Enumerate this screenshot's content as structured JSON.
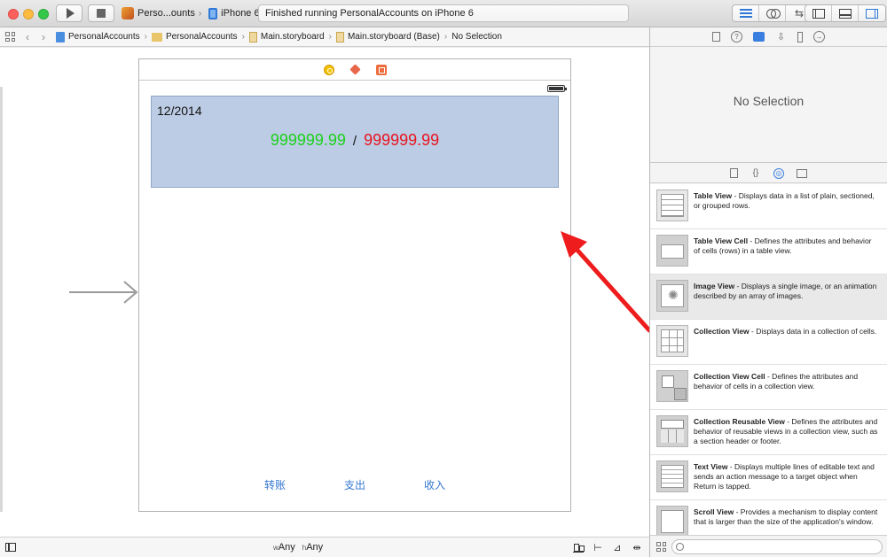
{
  "toolbar": {
    "scheme_name": "Perso...ounts",
    "scheme_separator": "›",
    "device_name": "iPhone 6",
    "activity_status": "Finished running PersonalAccounts on iPhone 6",
    "arrows_glyph": "⇆"
  },
  "jumpbar": {
    "back_glyph": "‹",
    "forward_glyph": "›",
    "separator": "›",
    "crumbs": [
      "PersonalAccounts",
      "PersonalAccounts",
      "Main.storyboard",
      "Main.storyboard (Base)",
      "No Selection"
    ]
  },
  "scene": {
    "date_label": "12/2014",
    "amount_left": "999999.99",
    "amount_separator": "/",
    "amount_right": "999999.99",
    "tabs": [
      "转账",
      "支出",
      "收入"
    ],
    "colors": {
      "header_bg": "#bccce4",
      "amount_left": "#1bd11b",
      "amount_right": "#e8131e",
      "tab_text": "#3478d0"
    }
  },
  "canvas_bar": {
    "width_prefix": "w",
    "width_value": "Any",
    "height_prefix": "h",
    "height_value": "Any"
  },
  "inspector": {
    "no_selection": "No Selection",
    "help_glyph": "?",
    "connections_glyph": "→"
  },
  "library": {
    "code_glyph": "{}",
    "object_glyph": "◎",
    "items": [
      {
        "title": "Table View",
        "desc": " - Displays data in a list of plain, sectioned, or grouped rows.",
        "icon": "table-view-icon"
      },
      {
        "title": "Table View Cell",
        "desc": " - Defines the attributes and behavior of cells (rows) in a table view.",
        "icon": "table-view-cell-icon"
      },
      {
        "title": "Image View",
        "desc": " - Displays a single image, or an animation described by an array of images.",
        "icon": "image-view-icon"
      },
      {
        "title": "Collection View",
        "desc": " - Displays data in a collection of cells.",
        "icon": "collection-view-icon"
      },
      {
        "title": "Collection View Cell",
        "desc": " - Defines the attributes and behavior of cells in a collection view.",
        "icon": "collection-view-cell-icon"
      },
      {
        "title": "Collection Reusable View",
        "desc": " - Defines the attributes and behavior of reusable views in a collection view, such as a section header or footer.",
        "icon": "collection-reusable-view-icon"
      },
      {
        "title": "Text View",
        "desc": " - Displays multiple lines of editable text and sends an action message to a target object when Return is tapped.",
        "icon": "text-view-icon"
      },
      {
        "title": "Scroll View",
        "desc": " - Provides a mechanism to display content that is larger than the size of the application's window.",
        "icon": "scroll-view-icon"
      }
    ],
    "filter_placeholder": ""
  }
}
